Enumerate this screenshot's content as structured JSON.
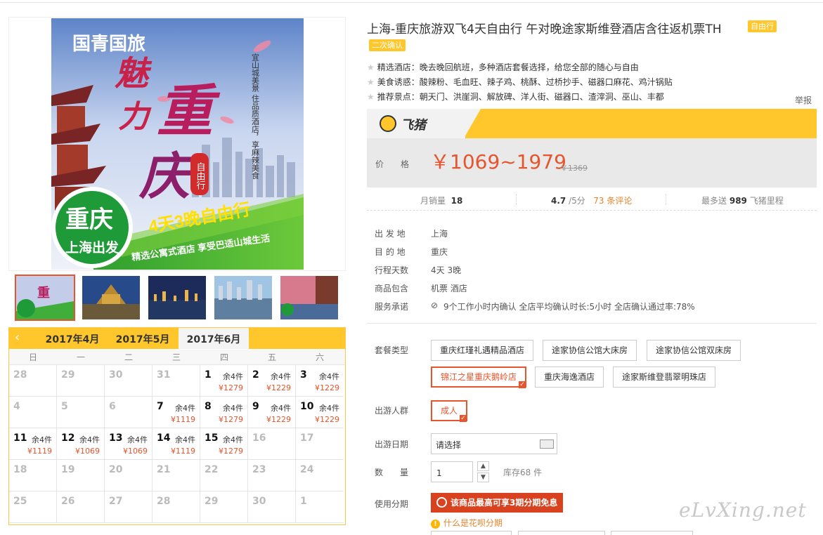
{
  "product": {
    "title": "上海-重庆旅游双飞4天自由行 午对晚途家斯维登酒店含往返机票TH",
    "tag_free": "自由行",
    "tag_confirm": "二次确认",
    "features": [
      "精选酒店：晚去晚回航班，多种酒店套餐选择，给您全部的随心与自由",
      "美食诱惑：酸辣粉、毛血旺、辣子鸡、桃酥、过桥抄手、磁器口麻花、鸡汁锅贴",
      "推荐景点：朝天门、洪崖洞、解放碑、洋人街、磁器口、渣滓洞、巫山、丰都"
    ],
    "report_label": "举报"
  },
  "hero": {
    "brand": "国青国旅",
    "big_title_1": "魅",
    "big_title_2": "力",
    "big_title_3": "重",
    "big_title_4": "庆",
    "badge_city": "重庆",
    "badge_from": "上海出发",
    "tagline": "4天3晚自由行",
    "subtagline": "精选公寓式酒店 享受巴适山城生活",
    "vertical_text": "宜山城美景 住品质酒店，享麻辣美食",
    "seal": "自由行"
  },
  "platform": {
    "name": "飞猪"
  },
  "price": {
    "label": "价　格",
    "value": "￥1069~1979",
    "original": "￥1369"
  },
  "stats": {
    "sales_label": "月销量",
    "sales_value": "18",
    "rating_value": "4.7",
    "rating_suffix": "/5分",
    "reviews": "73 条评论",
    "miles_prefix": "最多送",
    "miles_value": "989",
    "miles_suffix": "飞猪里程"
  },
  "info": [
    {
      "k": "出 发 地",
      "v": "上海"
    },
    {
      "k": "目 的 地",
      "v": "重庆"
    },
    {
      "k": "行程天数",
      "v": "4天 3晚"
    },
    {
      "k": "商品包含",
      "v": "机票  酒店"
    },
    {
      "k": "服务承诺",
      "v": "9个工作小时内确认    全店平均确认时长:5小时    全店确认通过率:78%"
    }
  ],
  "package": {
    "label": "套餐类型",
    "options": [
      "重庆红瑾礼遇精品酒店",
      "途家协信公馆大床房",
      "途家协信公馆双床房",
      "锦江之星重庆鹅岭店",
      "重庆海逸酒店",
      "途家斯维登翡翠明珠店"
    ]
  },
  "traveler": {
    "label": "出游人群",
    "option": "成人"
  },
  "date": {
    "label": "出游日期",
    "placeholder": "请选择"
  },
  "quantity": {
    "label": "数　　量",
    "value": "1",
    "stock": "库存68 件"
  },
  "installment": {
    "label": "使用分期",
    "button": "该商品最高可享3期分期免息",
    "help": "什么是花呗分期"
  },
  "calendar": {
    "tabs": [
      "2017年4月",
      "2017年5月",
      "2017年6月"
    ],
    "active_tab": 2,
    "weekdays": [
      "日",
      "一",
      "二",
      "三",
      "四",
      "五",
      "六"
    ],
    "weeks": [
      [
        {
          "d": "28",
          "past": true
        },
        {
          "d": "29",
          "past": true
        },
        {
          "d": "30",
          "past": true
        },
        {
          "d": "31",
          "past": true
        },
        {
          "d": "1",
          "s": "余4件",
          "p": "¥1279"
        },
        {
          "d": "2",
          "s": "余4件",
          "p": "¥1229"
        },
        {
          "d": "3",
          "s": "余4件",
          "p": "¥1229"
        }
      ],
      [
        {
          "d": "4",
          "past": true
        },
        {
          "d": "5",
          "past": true
        },
        {
          "d": "6",
          "past": true
        },
        {
          "d": "7",
          "s": "余4件",
          "p": "¥1119"
        },
        {
          "d": "8",
          "s": "余4件",
          "p": "¥1279"
        },
        {
          "d": "9",
          "s": "余4件",
          "p": "¥1229"
        },
        {
          "d": "10",
          "s": "余4件",
          "p": "¥1229"
        }
      ],
      [
        {
          "d": "11",
          "s": "余4件",
          "p": "¥1119"
        },
        {
          "d": "12",
          "s": "余4件",
          "p": "¥1069"
        },
        {
          "d": "13",
          "s": "余4件",
          "p": "¥1069"
        },
        {
          "d": "14",
          "s": "余4件",
          "p": "¥1119"
        },
        {
          "d": "15",
          "s": "余4件",
          "p": "¥1279"
        },
        {
          "d": "16",
          "past": true
        },
        {
          "d": "17",
          "past": true
        }
      ],
      [
        {
          "d": "18",
          "past": true
        },
        {
          "d": "19",
          "past": true
        },
        {
          "d": "20",
          "past": true
        },
        {
          "d": "21",
          "past": true
        },
        {
          "d": "22",
          "past": true
        },
        {
          "d": "23",
          "past": true
        },
        {
          "d": "24",
          "past": true
        }
      ],
      [
        {
          "d": "25",
          "past": true
        },
        {
          "d": "26",
          "past": true
        },
        {
          "d": "27",
          "past": true
        },
        {
          "d": "28",
          "past": true
        },
        {
          "d": "29",
          "past": true
        },
        {
          "d": "30",
          "past": true
        },
        {
          "d": "1",
          "past": true
        }
      ]
    ]
  },
  "watermark": "eLvXing.net",
  "colors": {
    "accent": "#ffc72c",
    "price": "#e8542b",
    "installment": "#d8421f"
  }
}
